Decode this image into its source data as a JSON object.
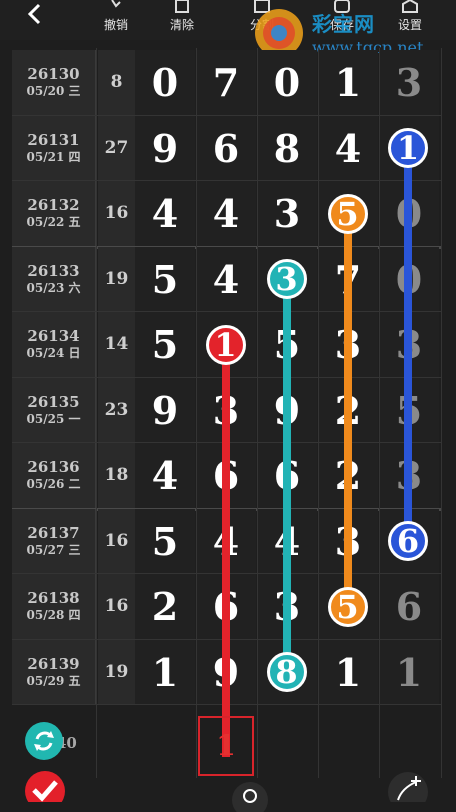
{
  "toolbar": {
    "undo": "撤销",
    "clear": "清除",
    "split": "分割",
    "save": "保存",
    "settings": "设置"
  },
  "watermark": {
    "name": "彩宝网",
    "url": "www.tqcp.net"
  },
  "rows": [
    {
      "period": "26130",
      "date": "05/20 三",
      "sum": "8",
      "d": [
        "0",
        "7",
        "0",
        "1",
        "3"
      ]
    },
    {
      "period": "26131",
      "date": "05/21 四",
      "sum": "27",
      "d": [
        "9",
        "6",
        "8",
        "4",
        "1"
      ]
    },
    {
      "period": "26132",
      "date": "05/22 五",
      "sum": "16",
      "d": [
        "4",
        "4",
        "3",
        "5",
        "0"
      ]
    },
    {
      "period": "26133",
      "date": "05/23 六",
      "sum": "19",
      "d": [
        "5",
        "4",
        "3",
        "7",
        "0"
      ]
    },
    {
      "period": "26134",
      "date": "05/24 日",
      "sum": "14",
      "d": [
        "5",
        "1",
        "5",
        "3",
        "3"
      ]
    },
    {
      "period": "26135",
      "date": "05/25 一",
      "sum": "23",
      "d": [
        "9",
        "3",
        "9",
        "2",
        "5"
      ]
    },
    {
      "period": "26136",
      "date": "05/26 二",
      "sum": "18",
      "d": [
        "4",
        "6",
        "6",
        "2",
        "3"
      ]
    },
    {
      "period": "26137",
      "date": "05/27 三",
      "sum": "16",
      "d": [
        "5",
        "4",
        "4",
        "3",
        "6"
      ]
    },
    {
      "period": "26138",
      "date": "05/28 四",
      "sum": "16",
      "d": [
        "2",
        "6",
        "3",
        "5",
        "6"
      ]
    },
    {
      "period": "26139",
      "date": "05/29 五",
      "sum": "19",
      "d": [
        "1",
        "9",
        "8",
        "1",
        "1"
      ]
    }
  ],
  "next_period_suffix": "40",
  "prediction": "1",
  "colors": {
    "red": "#e3232b",
    "teal": "#22b3b5",
    "orange": "#f08a1c",
    "blue": "#2a55d8"
  }
}
